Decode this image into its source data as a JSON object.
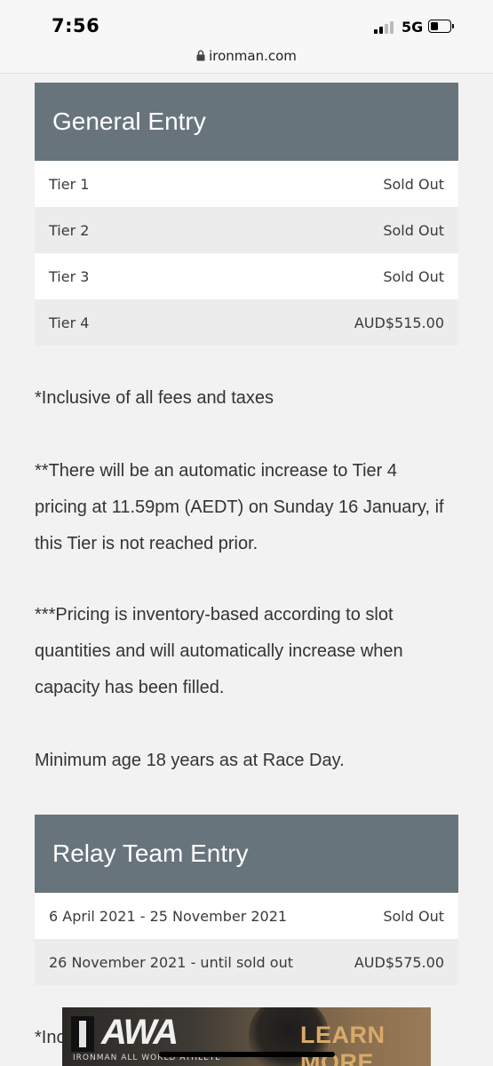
{
  "status_bar": {
    "time": "7:56",
    "network": "5G",
    "battery_level": 0.3
  },
  "browser": {
    "url": "ironman.com"
  },
  "general_entry": {
    "title": "General Entry",
    "rows": [
      {
        "label": "Tier 1",
        "price": "Sold Out"
      },
      {
        "label": "Tier 2",
        "price": "Sold Out"
      },
      {
        "label": "Tier 3",
        "price": "Sold Out"
      },
      {
        "label": "Tier 4",
        "price": "AUD$515.00"
      }
    ]
  },
  "notes": {
    "inclusive": "*Inclusive of all fees and taxes",
    "auto_increase": "**There will be an automatic increase to Tier 4 pricing at 11.59pm (AEDT) on Sunday 16 January, if this Tier is not reached prior.",
    "inventory": "***Pricing is inventory-based according to slot quantities and will automatically increase when capacity has been filled.",
    "min_age": "Minimum age 18 years as at Race Day."
  },
  "relay_entry": {
    "title": "Relay Team Entry",
    "rows": [
      {
        "label": "6 April 2021 - 25 November 2021",
        "price": "Sold Out"
      },
      {
        "label": "26 November 2021 - until sold out",
        "price": "AUD$575.00"
      }
    ],
    "partial_note": "*Inc"
  },
  "ad": {
    "brand": "AWA",
    "subtitle": "IRONMAN ALL WORLD ATHLETE",
    "cta": "LEARN MORE"
  },
  "colors": {
    "header_bg": "#68747c",
    "page_bg": "#f2f2f2",
    "cta": "#d8aa6a"
  }
}
